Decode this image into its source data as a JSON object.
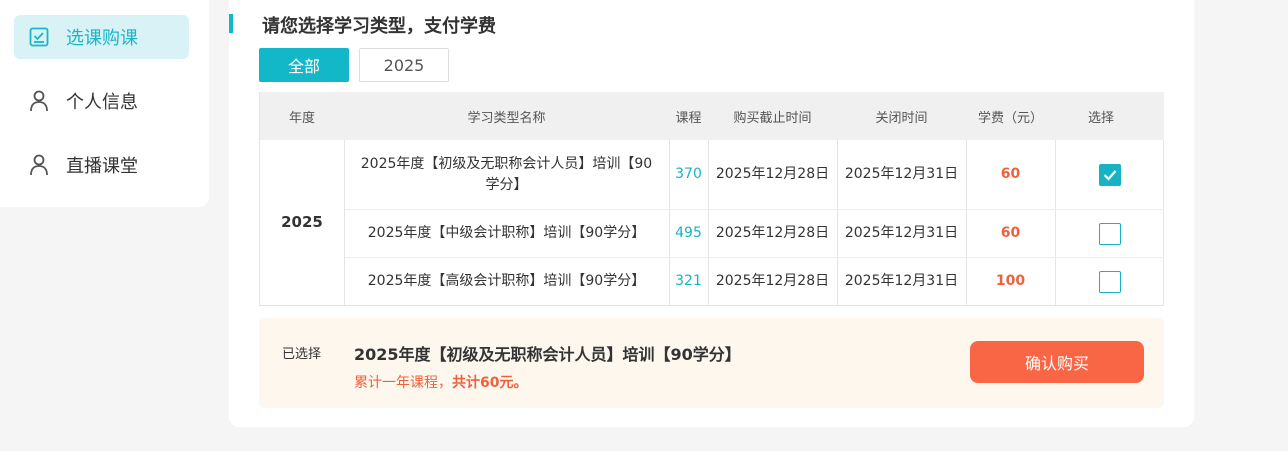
{
  "sidebar": {
    "items": [
      {
        "label": "选课购课",
        "icon": "checklist-icon",
        "active": true
      },
      {
        "label": "个人信息",
        "icon": "user-icon",
        "active": false
      },
      {
        "label": "直播课堂",
        "icon": "user-icon",
        "active": false
      }
    ]
  },
  "main": {
    "title": "请您选择学习类型，支付学费",
    "tabs": [
      {
        "label": "全部",
        "active": true
      },
      {
        "label": "2025",
        "active": false
      }
    ],
    "table": {
      "headers": [
        "年度",
        "学习类型名称",
        "课程",
        "购买截止时间",
        "关闭时间",
        "学费（元）",
        "选择"
      ],
      "year": "2025",
      "rows": [
        {
          "name": "2025年度【初级及无职称会计人员】培训【90学分】",
          "lessons": "370",
          "deadline": "2025年12月28日",
          "close": "2025年12月31日",
          "fee": "60",
          "selected": true
        },
        {
          "name": "2025年度【中级会计职称】培训【90学分】",
          "lessons": "495",
          "deadline": "2025年12月28日",
          "close": "2025年12月31日",
          "fee": "60",
          "selected": false
        },
        {
          "name": "2025年度【高级会计职称】培训【90学分】",
          "lessons": "321",
          "deadline": "2025年12月28日",
          "close": "2025年12月31日",
          "fee": "100",
          "selected": false
        }
      ]
    },
    "summary": {
      "label": "已选择",
      "selected_name": "2025年度【初级及无职称会计人员】培训【90学分】",
      "total_prefix": "累计一年课程，",
      "total_value": "共计60元。",
      "confirm_label": "确认购买"
    }
  },
  "colors": {
    "accent": "#12b8c8",
    "fee": "#f0603a",
    "confirm": "#f96645",
    "summary_bg": "#fdf7ee"
  }
}
